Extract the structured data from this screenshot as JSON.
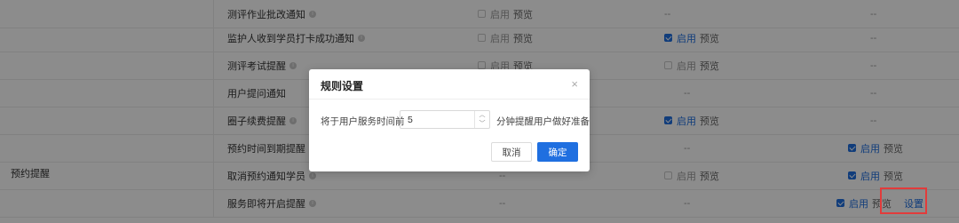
{
  "category": "预约提醒",
  "enable_label": "启用",
  "preview_label": "预览",
  "dash": "--",
  "settings_link": "设置",
  "rows": [
    {
      "name": "测评作业批改通知"
    },
    {
      "name": "监护人收到学员打卡成功通知"
    },
    {
      "name": "测评考试提醒"
    },
    {
      "name": "用户提问通知"
    },
    {
      "name": "圈子续费提醒"
    },
    {
      "name": "预约时间到期提醒"
    },
    {
      "name": "取消预约通知学员"
    },
    {
      "name": "服务即将开启提醒"
    }
  ],
  "modal": {
    "title": "规则设置",
    "close": "×",
    "prefix": "将于用户服务时间前",
    "value": "5",
    "suffix": "分钟提醒用户做好准备",
    "cancel": "取消",
    "confirm": "确定"
  },
  "colors": {
    "accent": "#1f6fe0",
    "highlight": "#e23b3b"
  }
}
